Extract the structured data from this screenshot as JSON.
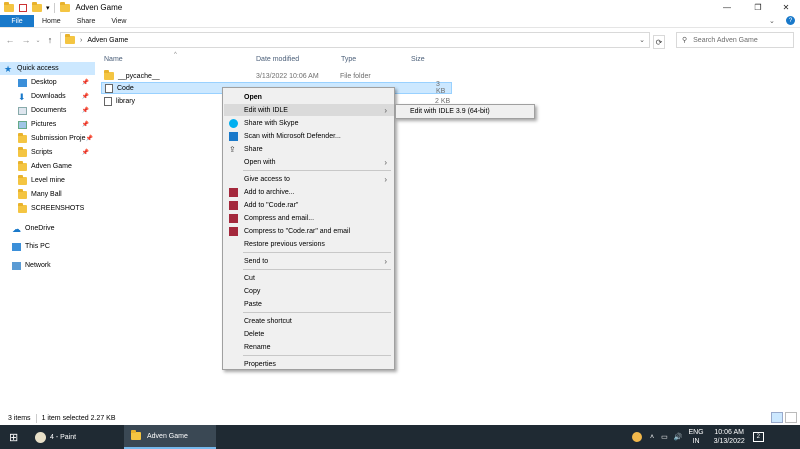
{
  "window": {
    "title": "Adven Game",
    "controls": [
      "minimize-icon",
      "maximize-icon",
      "close-icon"
    ]
  },
  "ribbon": {
    "tabs": [
      "File",
      "Home",
      "Share",
      "View"
    ]
  },
  "address": {
    "path": "Adven Game",
    "search_placeholder": "Search Adven Game"
  },
  "sidebar": {
    "items": [
      {
        "label": "Quick access",
        "icon": "star-icon"
      },
      {
        "label": "Desktop",
        "icon": "desktop-icon"
      },
      {
        "label": "Downloads",
        "icon": "download-icon"
      },
      {
        "label": "Documents",
        "icon": "documents-icon"
      },
      {
        "label": "Pictures",
        "icon": "pictures-icon"
      },
      {
        "label": "Submission Proje",
        "icon": "folder-icon"
      },
      {
        "label": "Scripts",
        "icon": "folder-icon"
      },
      {
        "label": "Adven Game",
        "icon": "folder-icon"
      },
      {
        "label": "Level mine",
        "icon": "folder-icon"
      },
      {
        "label": "Many Ball",
        "icon": "folder-icon"
      },
      {
        "label": "SCREENSHOTS",
        "icon": "folder-icon"
      },
      {
        "label": "OneDrive",
        "icon": "cloud-icon"
      },
      {
        "label": "This PC",
        "icon": "computer-icon"
      },
      {
        "label": "Network",
        "icon": "network-icon"
      }
    ]
  },
  "columns": {
    "name": "Name",
    "date": "Date modified",
    "type": "Type",
    "size": "Size"
  },
  "files": [
    {
      "name": "__pycache__",
      "date": "3/13/2022 10:06 AM",
      "type": "File folder",
      "size": ""
    },
    {
      "name": "Code",
      "date": "",
      "type": "",
      "size": "3 KB"
    },
    {
      "name": "library",
      "date": "",
      "type": "",
      "size": "2 KB"
    }
  ],
  "context_menu": {
    "items": [
      {
        "label": "Open",
        "bold": true
      },
      {
        "label": "Edit with IDLE",
        "submenu": true
      },
      {
        "label": "Share with Skype",
        "icon": "skype-icon"
      },
      {
        "label": "Scan with Microsoft Defender...",
        "icon": "defender-icon"
      },
      {
        "label": "Share",
        "icon": "share-icon"
      },
      {
        "label": "Open with",
        "submenu": true
      },
      {
        "label": "Give access to",
        "submenu": true
      },
      {
        "label": "Add to archive...",
        "icon": "winrar-icon"
      },
      {
        "label": "Add to \"Code.rar\"",
        "icon": "winrar-icon"
      },
      {
        "label": "Compress and email...",
        "icon": "winrar-icon"
      },
      {
        "label": "Compress to \"Code.rar\" and email",
        "icon": "winrar-icon"
      },
      {
        "label": "Restore previous versions"
      },
      {
        "label": "Send to",
        "submenu": true
      },
      {
        "label": "Cut"
      },
      {
        "label": "Copy"
      },
      {
        "label": "Paste"
      },
      {
        "label": "Create shortcut"
      },
      {
        "label": "Delete"
      },
      {
        "label": "Rename"
      },
      {
        "label": "Properties"
      }
    ],
    "submenu": "Edit with IDLE 3.9 (64-bit)"
  },
  "status": {
    "count": "3 items",
    "selection": "1 item selected  2.27 KB"
  },
  "taskbar": {
    "apps": [
      "4 - Paint",
      "Adven Game"
    ],
    "lang": "ENG",
    "region": "IN",
    "time": "10:06 AM",
    "date": "3/13/2022",
    "notifications": "2"
  },
  "colors": {
    "accent": "#1979ca",
    "selection": "#cce8ff",
    "taskbar": "#1f2a33"
  }
}
